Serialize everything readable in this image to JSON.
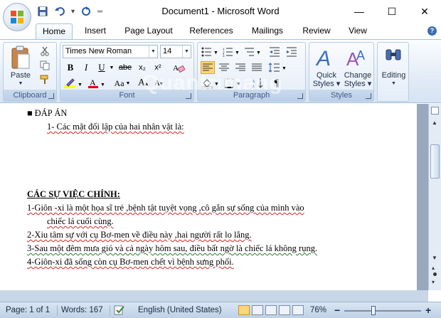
{
  "window": {
    "title": "Document1 - Microsoft Word",
    "controls": {
      "minimize": "—",
      "maximize": "☐",
      "close": "✕"
    }
  },
  "quick_access": {
    "icons": [
      "save-icon",
      "undo-icon",
      "redo-icon",
      "customize-icon"
    ],
    "undo_dropdown": "▾"
  },
  "tabs": [
    {
      "label": "Home",
      "active": true
    },
    {
      "label": "Insert",
      "active": false
    },
    {
      "label": "Page Layout",
      "active": false
    },
    {
      "label": "References",
      "active": false
    },
    {
      "label": "Mailings",
      "active": false
    },
    {
      "label": "Review",
      "active": false
    },
    {
      "label": "View",
      "active": false
    }
  ],
  "ribbon": {
    "clipboard": {
      "label": "Clipboard",
      "paste_label": "Paste"
    },
    "font": {
      "label": "Font",
      "font_name": "Times New Roman",
      "font_size": "14",
      "bold": "B",
      "italic": "I",
      "underline": "U",
      "grow": "A",
      "shrink": "A",
      "strike": "abe",
      "sub": "x₂",
      "sup": "x²",
      "change_case": "Aa",
      "font_color": "A"
    },
    "paragraph": {
      "label": "Paragraph",
      "show_marks": "¶"
    },
    "styles": {
      "label": "Styles",
      "quick_styles": "Quick\nStyles",
      "quick_styles_l1": "Quick",
      "quick_styles_l2": "Styles ▾",
      "change_styles_l1": "Change",
      "change_styles_l2": "Styles ▾"
    },
    "editing": {
      "label": "Editing"
    }
  },
  "watermark": "Quantrimang",
  "document": {
    "lines": [
      {
        "text": "■   ĐÁP ÁN",
        "style": "plain"
      },
      {
        "text": "1- Các mặt đối lập của hai nhân vật là:",
        "style": "squig-indent"
      },
      {
        "text": "",
        "style": "plain"
      },
      {
        "text": "",
        "style": "plain"
      },
      {
        "text": "",
        "style": "plain"
      },
      {
        "text": "",
        "style": "plain"
      },
      {
        "text": "CÁC SỰ VIỆC CHÍNH:",
        "style": "heading"
      },
      {
        "text": "1-Giôn -xi là một họa sĩ trẻ ,bệnh tật tuyệt vọng ,cô gắn sự sống của mình vào",
        "style": "squig"
      },
      {
        "text": "chiếc lá cuối cùng.",
        "style": "squig-indent2"
      },
      {
        "text": "2-Xiu tâm sự với cụ Bơ-men về điều này ,hai người rất lo lắng.",
        "style": "squig"
      },
      {
        "text": "3-Sau một đêm mưa gió và cả ngày hôm sau, điều bất ngờ là chiếc lá không rụng.",
        "style": "gsquig"
      },
      {
        "text": "4-Giôn-xi đã sống còn cụ Bơ-men chết vì bệnh sưng phổi.",
        "style": "squig"
      }
    ]
  },
  "status": {
    "page": "Page: 1 of 1",
    "words": "Words: 167",
    "language": "English (United States)",
    "zoom": "76%",
    "zoom_minus": "−",
    "zoom_plus": "+"
  },
  "colors": {
    "accent": "#2b579a",
    "highlight": "#ffff00",
    "font_color": "#e00000"
  }
}
